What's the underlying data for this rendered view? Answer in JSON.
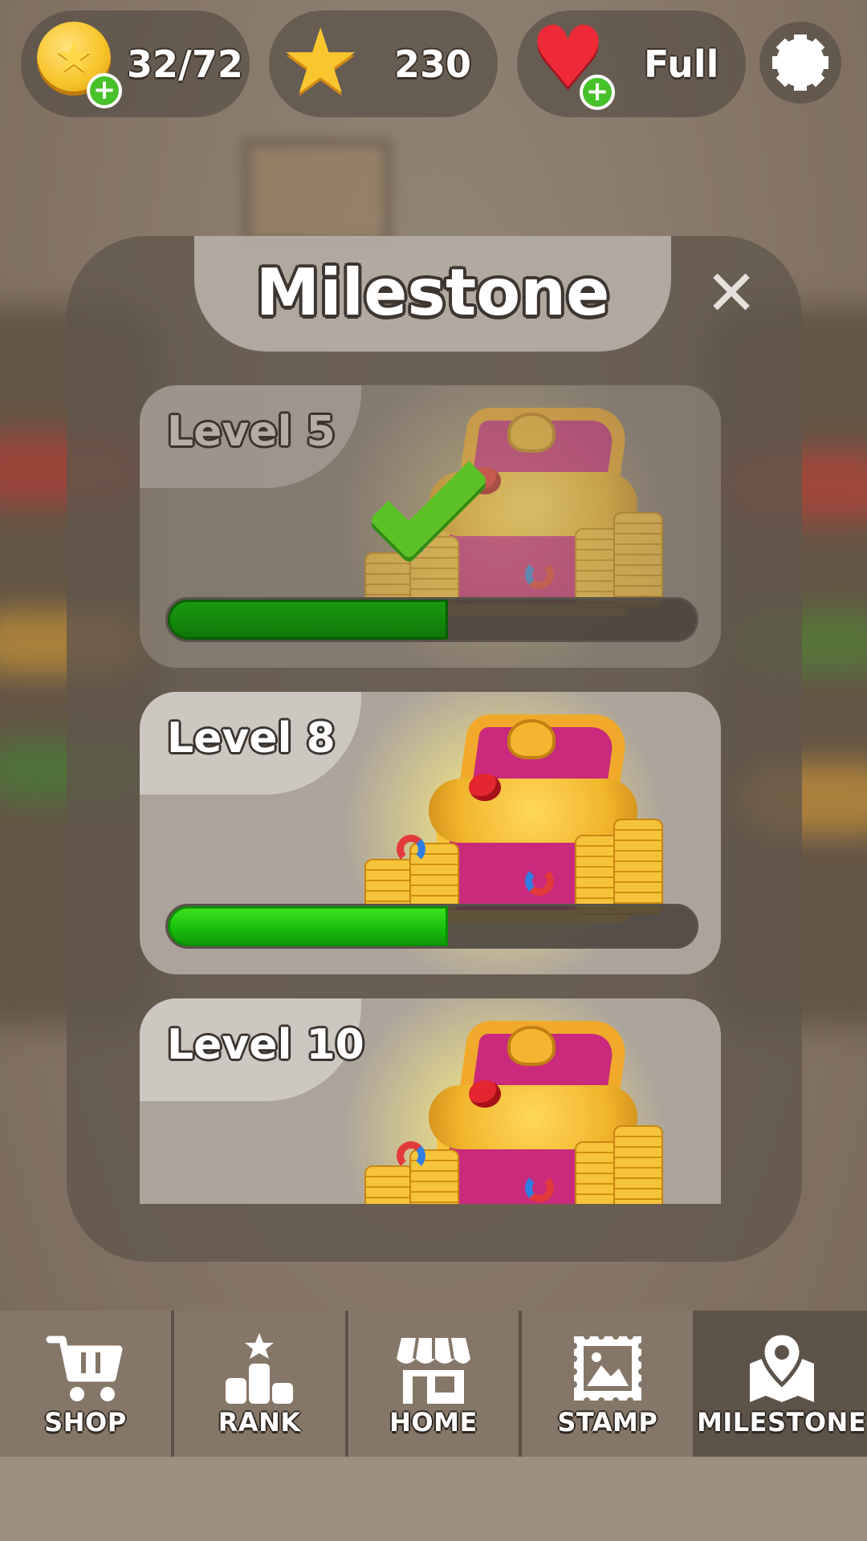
{
  "hud": {
    "coins_value": "32/72",
    "stars_value": "230",
    "lives_value": "Full",
    "coin_add_symbol": "+",
    "lives_add_symbol": "+"
  },
  "modal": {
    "title": "Milestone",
    "close_symbol": "✕",
    "milestones": [
      {
        "level": "Level 5",
        "completed": true,
        "progress": 0.53
      },
      {
        "level": "Level 8",
        "completed": false,
        "progress": 0.53
      },
      {
        "level": "Level 10",
        "completed": false,
        "progress": null
      }
    ]
  },
  "nav": {
    "items": [
      {
        "label": "SHOP",
        "icon": "cart-icon"
      },
      {
        "label": "RANK",
        "icon": "podium-icon"
      },
      {
        "label": "HOME",
        "icon": "store-icon"
      },
      {
        "label": "STAMP",
        "icon": "stamp-icon"
      },
      {
        "label": "MILESTONE",
        "icon": "map-pin-icon"
      }
    ],
    "active": "MILESTONE"
  },
  "colors": {
    "progress_green": "#18c00c",
    "checkmark_green": "#5ac225",
    "nav_active": "#5e5349"
  }
}
